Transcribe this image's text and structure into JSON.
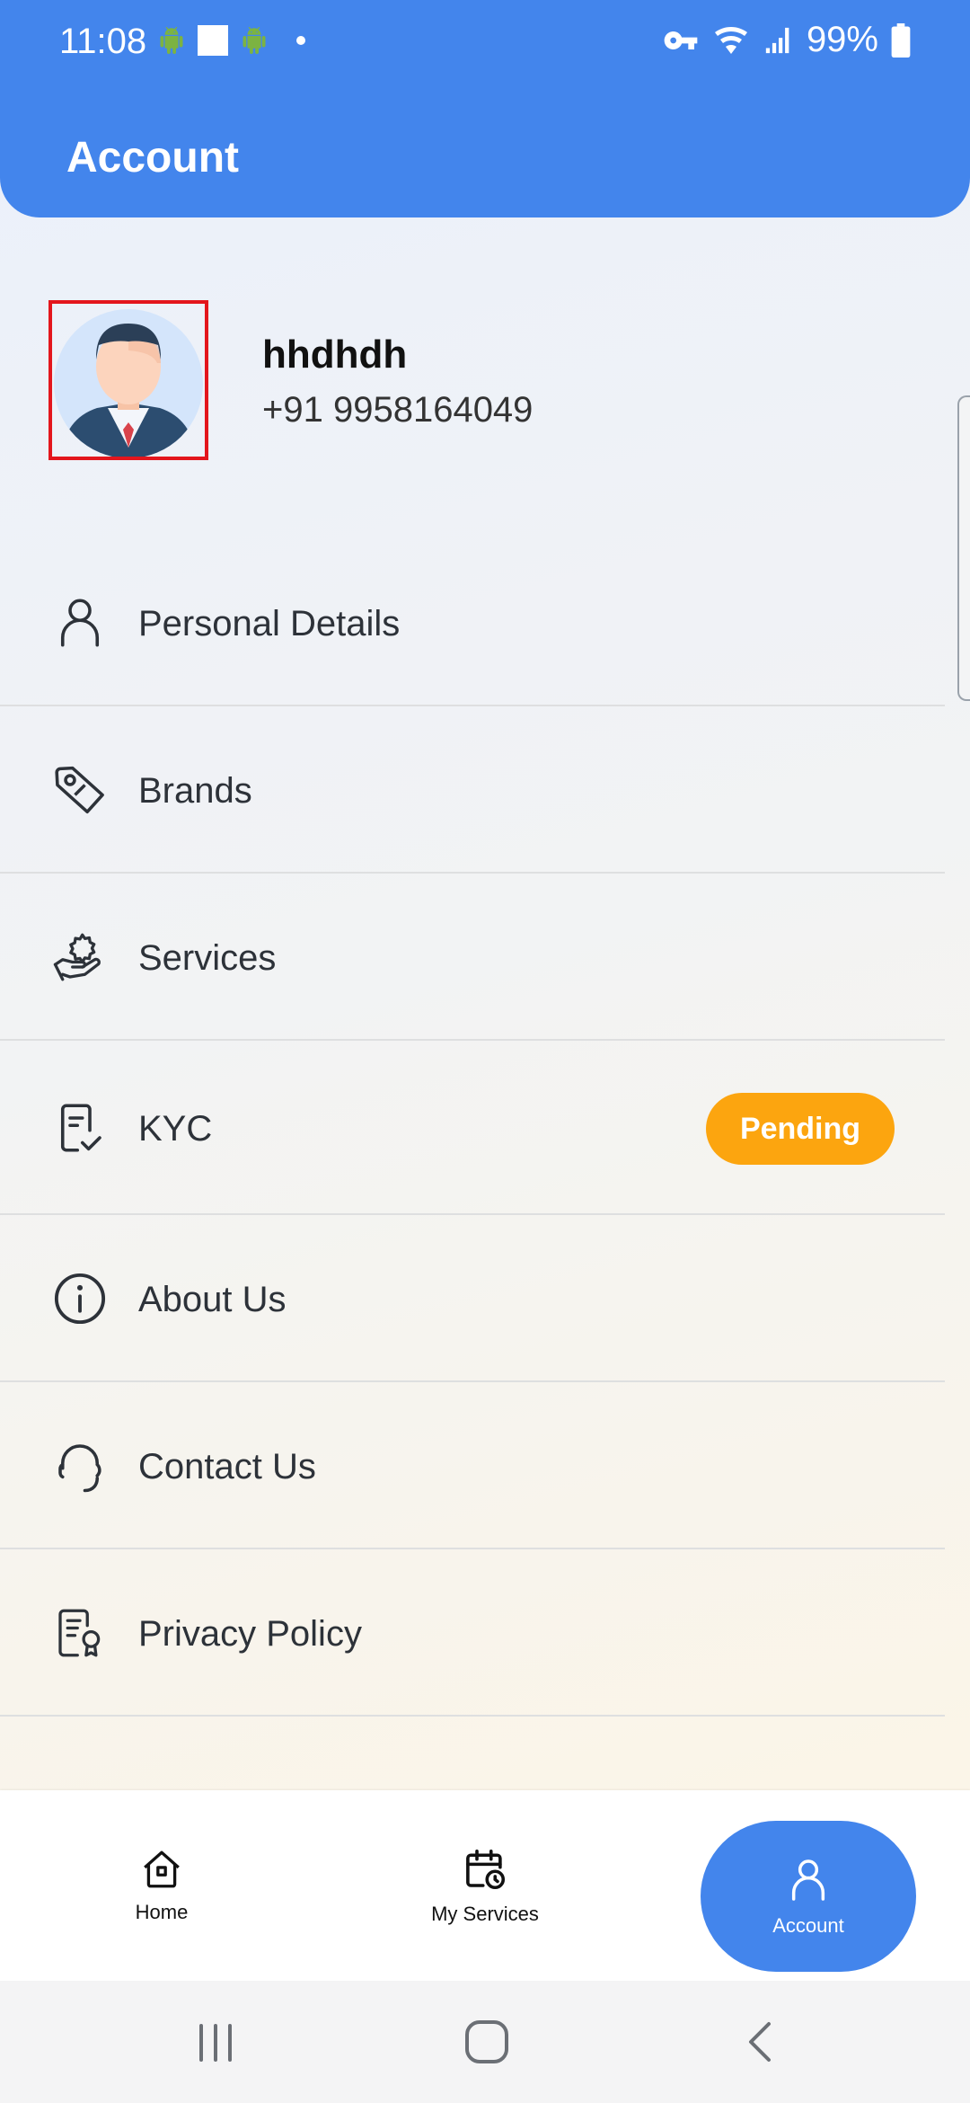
{
  "status_bar": {
    "time": "11:08",
    "battery": "99%",
    "icons_left": [
      "android-icon",
      "square-notification-icon",
      "android-icon",
      "dot-icon"
    ],
    "icons_right": [
      "vpn-key-icon",
      "wifi-icon",
      "signal-icon",
      "battery-icon"
    ]
  },
  "header": {
    "title": "Account"
  },
  "profile": {
    "name": "hhdhdh",
    "phone": "+91 9958164049"
  },
  "menu": [
    {
      "label": "Personal Details",
      "icon": "user-icon"
    },
    {
      "label": "Brands",
      "icon": "tag-icon"
    },
    {
      "label": "Services",
      "icon": "service-hand-icon"
    },
    {
      "label": "KYC",
      "icon": "document-check-icon",
      "badge": "Pending"
    },
    {
      "label": "About Us",
      "icon": "info-icon"
    },
    {
      "label": "Contact Us",
      "icon": "headset-icon"
    },
    {
      "label": "Privacy Policy",
      "icon": "certificate-document-icon"
    }
  ],
  "bottom_nav": {
    "items": [
      {
        "label": "Home",
        "icon": "home-icon"
      },
      {
        "label": "My Services",
        "icon": "calendar-icon"
      },
      {
        "label": "Account",
        "icon": "user-icon",
        "active": true
      }
    ]
  },
  "colors": {
    "primary": "#4385ec",
    "badge": "#fca50f",
    "highlight_border": "#e3161d"
  }
}
